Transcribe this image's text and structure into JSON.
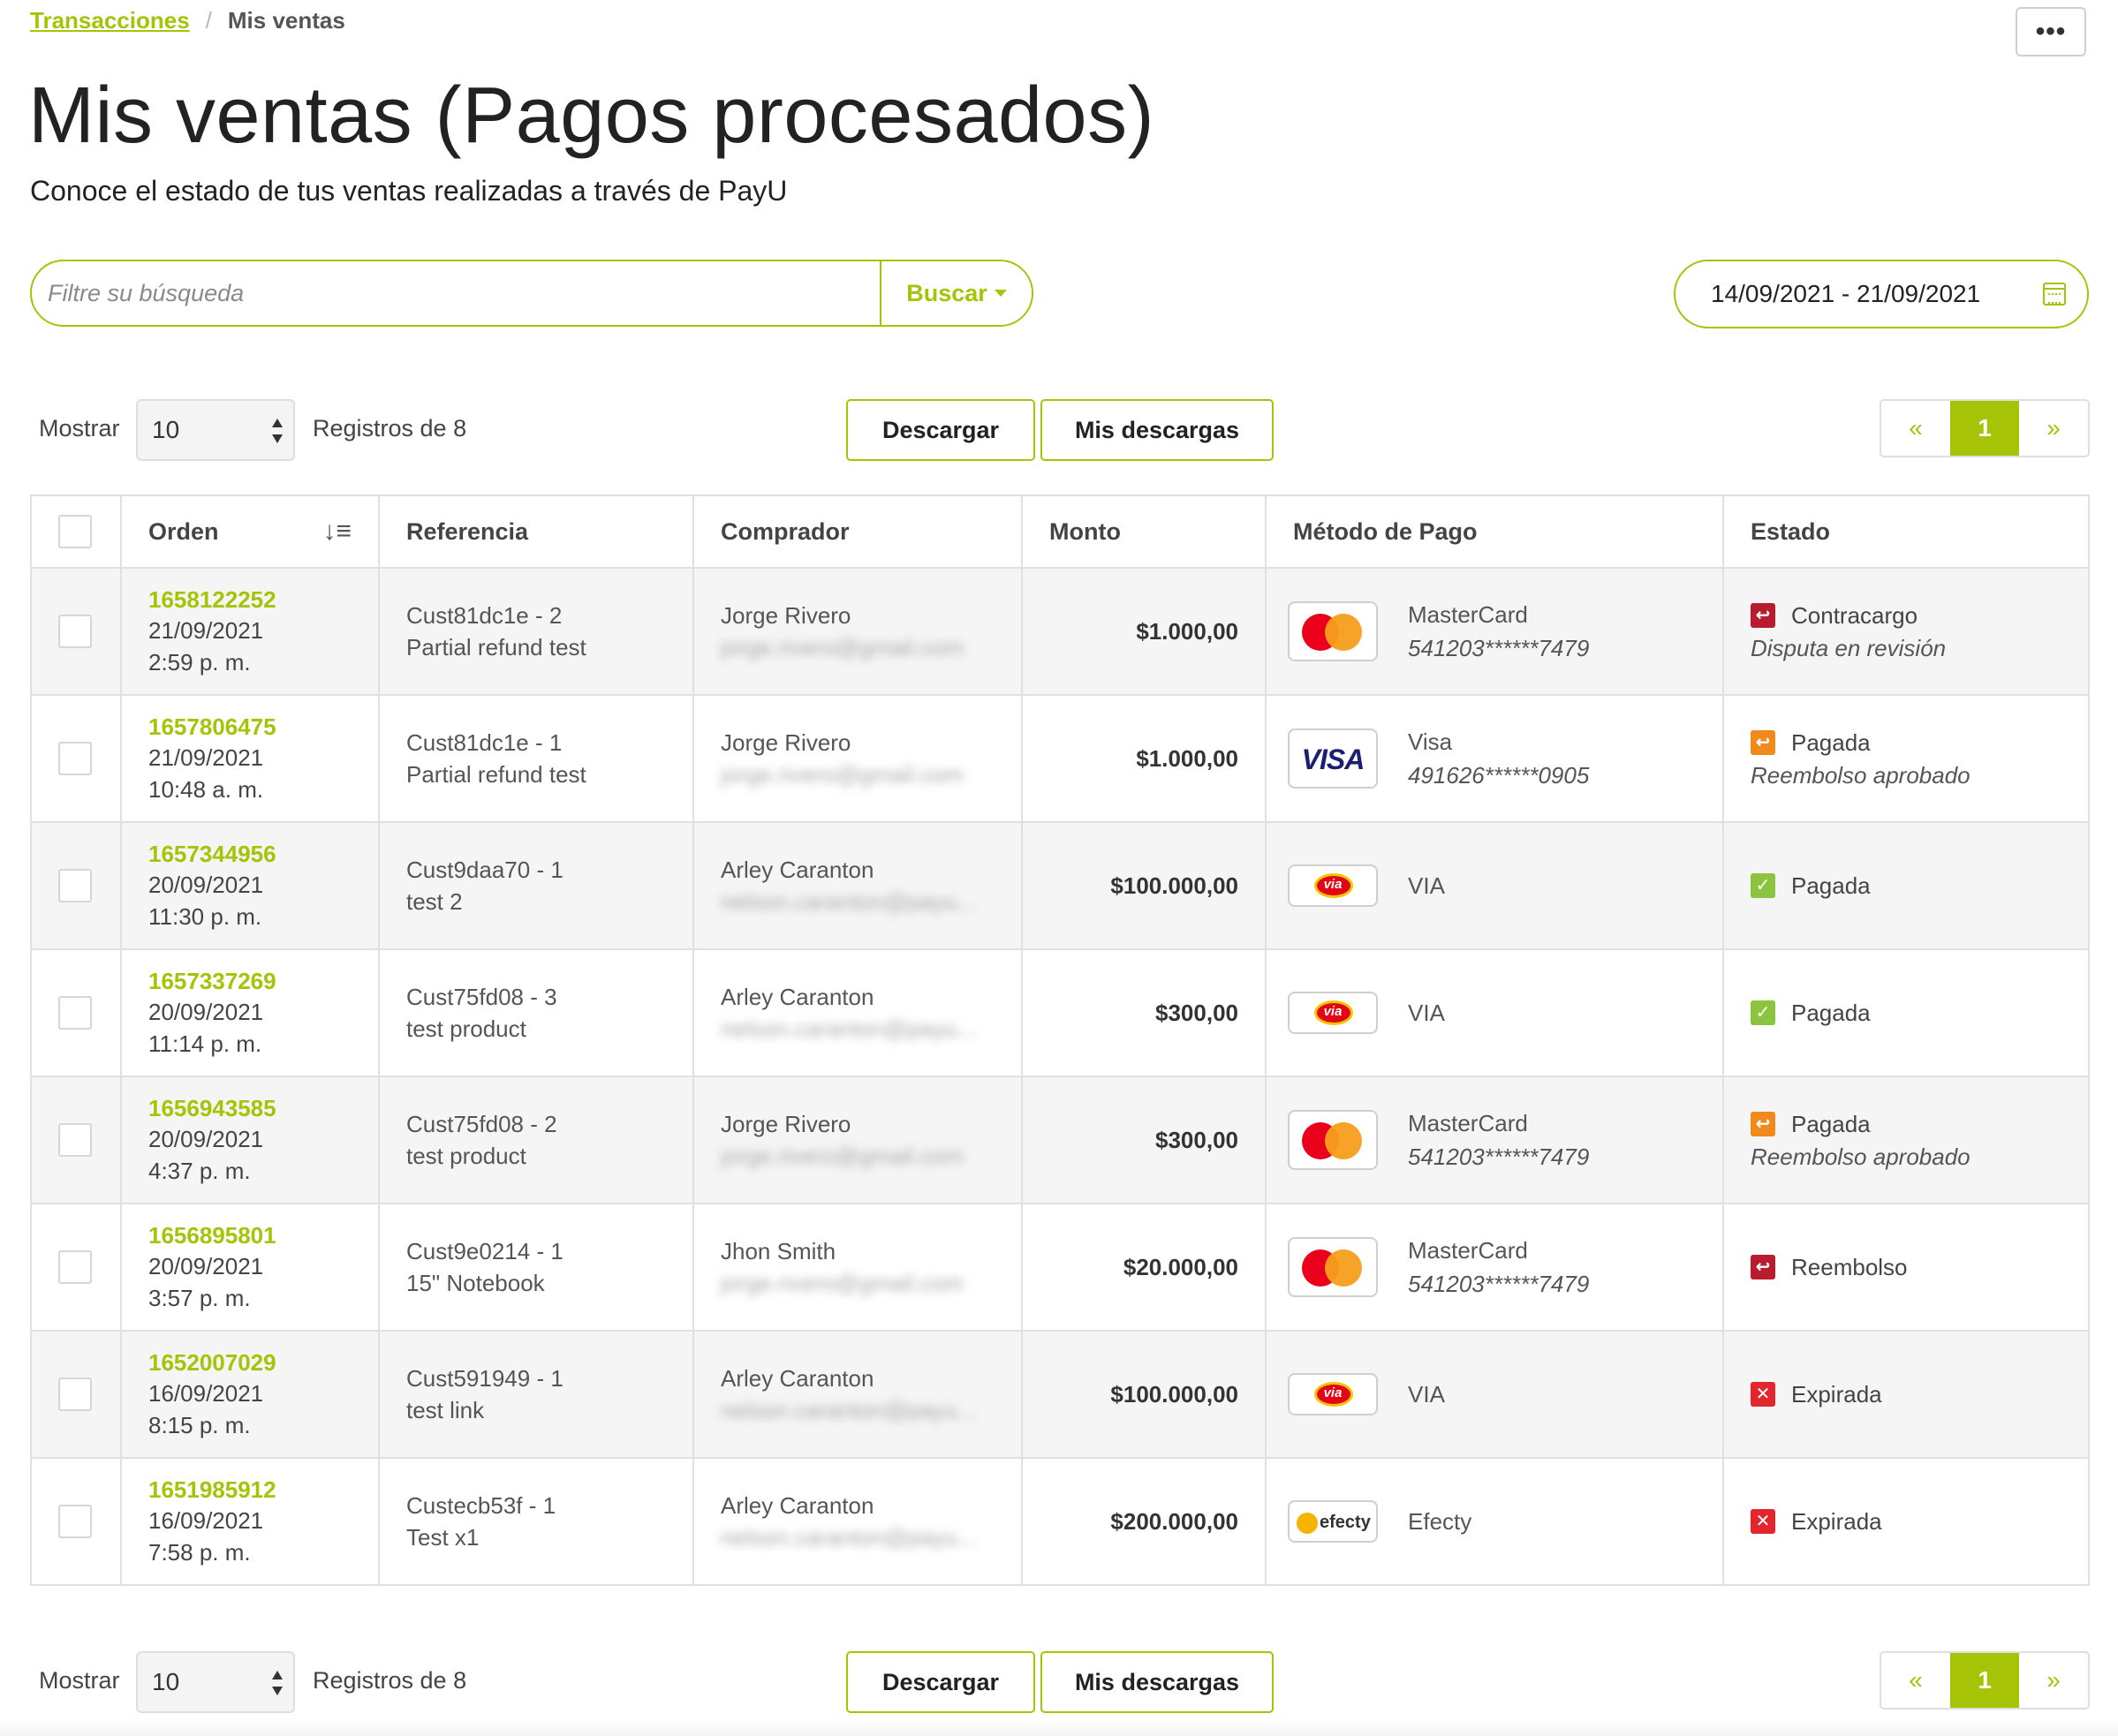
{
  "breadcrumb": {
    "parent": "Transacciones",
    "separator": "/",
    "current": "Mis ventas"
  },
  "more_menu_label": "•••",
  "page": {
    "title": "Mis ventas (Pagos procesados)",
    "subtitle": "Conoce el estado de tus ventas realizadas a través de PayU"
  },
  "search": {
    "placeholder": "Filtre su búsqueda",
    "value": "",
    "button_label": "Buscar"
  },
  "date_range": {
    "value": "14/09/2021 - 21/09/2021"
  },
  "controls": {
    "show_label": "Mostrar",
    "page_size": "10",
    "records_label": "Registros de 8",
    "download_label": "Descargar",
    "my_downloads_label": "Mis descargas",
    "pager": {
      "prev": "«",
      "current": "1",
      "next": "»"
    }
  },
  "table": {
    "headers": {
      "order": "Orden",
      "reference": "Referencia",
      "buyer": "Comprador",
      "amount": "Monto",
      "method": "Método de Pago",
      "status": "Estado"
    },
    "rows": [
      {
        "order_id": "1658122252",
        "date": "21/09/2021",
        "time": "2:59 p. m.",
        "ref_id": "Cust81dc1e - 2",
        "ref_desc": "Partial refund test",
        "buyer": "Jorge Rivero",
        "email": "jorge.rivero@gmail.com",
        "amount": "$1.000,00",
        "method": "MasterCard",
        "method_icon": "mastercard-logo",
        "card": "541203******7479",
        "status": "Contracargo",
        "status_icon": "chargeback-icon",
        "status_sub": "Disputa en revisión"
      },
      {
        "order_id": "1657806475",
        "date": "21/09/2021",
        "time": "10:48 a. m.",
        "ref_id": "Cust81dc1e - 1",
        "ref_desc": "Partial refund test",
        "buyer": "Jorge Rivero",
        "email": "jorge.rivero@gmail.com",
        "amount": "$1.000,00",
        "method": "Visa",
        "method_icon": "visa-logo",
        "card": "491626******0905",
        "status": "Pagada",
        "status_icon": "refund-approved-icon",
        "status_sub": "Reembolso aprobado"
      },
      {
        "order_id": "1657344956",
        "date": "20/09/2021",
        "time": "11:30 p. m.",
        "ref_id": "Cust9daa70 - 1",
        "ref_desc": "test 2",
        "buyer": "Arley Caranton",
        "email": "nelson.caranton@payu...",
        "amount": "$100.000,00",
        "method": "VIA",
        "method_icon": "via-logo",
        "card": "",
        "status": "Pagada",
        "status_icon": "check-icon",
        "status_sub": ""
      },
      {
        "order_id": "1657337269",
        "date": "20/09/2021",
        "time": "11:14 p. m.",
        "ref_id": "Cust75fd08 - 3",
        "ref_desc": "test product",
        "buyer": "Arley Caranton",
        "email": "nelson.caranton@payu...",
        "amount": "$300,00",
        "method": "VIA",
        "method_icon": "via-logo",
        "card": "",
        "status": "Pagada",
        "status_icon": "check-icon",
        "status_sub": ""
      },
      {
        "order_id": "1656943585",
        "date": "20/09/2021",
        "time": "4:37 p. m.",
        "ref_id": "Cust75fd08 - 2",
        "ref_desc": "test product",
        "buyer": "Jorge Rivero",
        "email": "jorge.rivero@gmail.com",
        "amount": "$300,00",
        "method": "MasterCard",
        "method_icon": "mastercard-logo",
        "card": "541203******7479",
        "status": "Pagada",
        "status_icon": "refund-approved-icon",
        "status_sub": "Reembolso aprobado"
      },
      {
        "order_id": "1656895801",
        "date": "20/09/2021",
        "time": "3:57 p. m.",
        "ref_id": "Cust9e0214 - 1",
        "ref_desc": "15\" Notebook",
        "buyer": "Jhon Smith",
        "email": "jorge.rivero@gmail.com",
        "amount": "$20.000,00",
        "method": "MasterCard",
        "method_icon": "mastercard-logo",
        "card": "541203******7479",
        "status": "Reembolso",
        "status_icon": "refund-icon",
        "status_sub": ""
      },
      {
        "order_id": "1652007029",
        "date": "16/09/2021",
        "time": "8:15 p. m.",
        "ref_id": "Cust591949 - 1",
        "ref_desc": "test link",
        "buyer": "Arley Caranton",
        "email": "nelson.caranton@payu...",
        "amount": "$100.000,00",
        "method": "VIA",
        "method_icon": "via-logo",
        "card": "",
        "status": "Expirada",
        "status_icon": "expired-icon",
        "status_sub": ""
      },
      {
        "order_id": "1651985912",
        "date": "16/09/2021",
        "time": "7:58 p. m.",
        "ref_id": "Custecb53f - 1",
        "ref_desc": "Test x1",
        "buyer": "Arley Caranton",
        "email": "nelson.caranton@payu...",
        "amount": "$200.000,00",
        "method": "Efecty",
        "method_icon": "efecty-logo",
        "card": "",
        "status": "Expirada",
        "status_icon": "expired-icon",
        "status_sub": ""
      }
    ]
  },
  "colors": {
    "accent": "#a6c307",
    "chargeback": "#b71c2f",
    "refund_approved": "#f08a1c",
    "paid": "#8bc43f",
    "expired": "#e3262d"
  }
}
